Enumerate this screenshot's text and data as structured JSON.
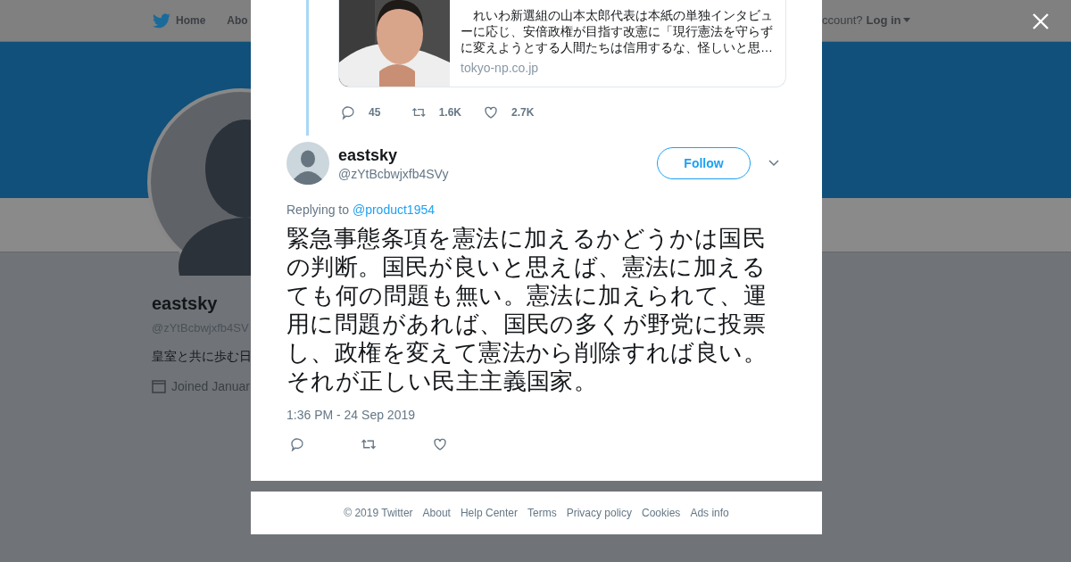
{
  "background_page": {
    "nav": [
      {
        "label": "Home",
        "kind": "home"
      },
      {
        "label": "Abo",
        "kind": "plain"
      }
    ],
    "account_prompt": "ccount?",
    "login": "Log in",
    "profile": {
      "name": "eastsky",
      "handle": "@zYtBcbwjxfb4SV",
      "bio": "皇室と共に歩む日",
      "joined": "Joined Januar"
    }
  },
  "quoted_card": {
    "description": "　れいわ新選組の山本太郎代表は本紙の単独インタビューに応じ、安倍政権が目指す改憲に「現行憲法を守らずに変えようとする人間たちは信用するな、怪しいと思…",
    "domain": "tokyo-np.co.jp"
  },
  "parent_stats": [
    {
      "kind": "reply",
      "count": "45"
    },
    {
      "kind": "retweet",
      "count": "1.6K"
    },
    {
      "kind": "like",
      "count": "2.7K"
    }
  ],
  "tweet": {
    "name": "eastsky",
    "handle": "@zYtBcbwjxfb4SVy",
    "follow": "Follow",
    "replying_label": "Replying to",
    "replying_to": "@product1954",
    "text": "緊急事態条項を憲法に加えるかどうかは国民の判断。国民が良いと思えば、憲法に加えるても何の問題も無い。憲法に加えられて、運用に問題があれば、国民の多くが野党に投票し、政権を変えて憲法から削除すれば良い。それが正しい民主主義国家。",
    "time": "1:36 PM - 24 Sep 2019",
    "actions": [
      {
        "kind": "reply"
      },
      {
        "kind": "retweet"
      },
      {
        "kind": "like"
      }
    ]
  },
  "footer": [
    "© 2019 Twitter",
    "About",
    "Help Center",
    "Terms",
    "Privacy policy",
    "Cookies",
    "Ads info"
  ]
}
